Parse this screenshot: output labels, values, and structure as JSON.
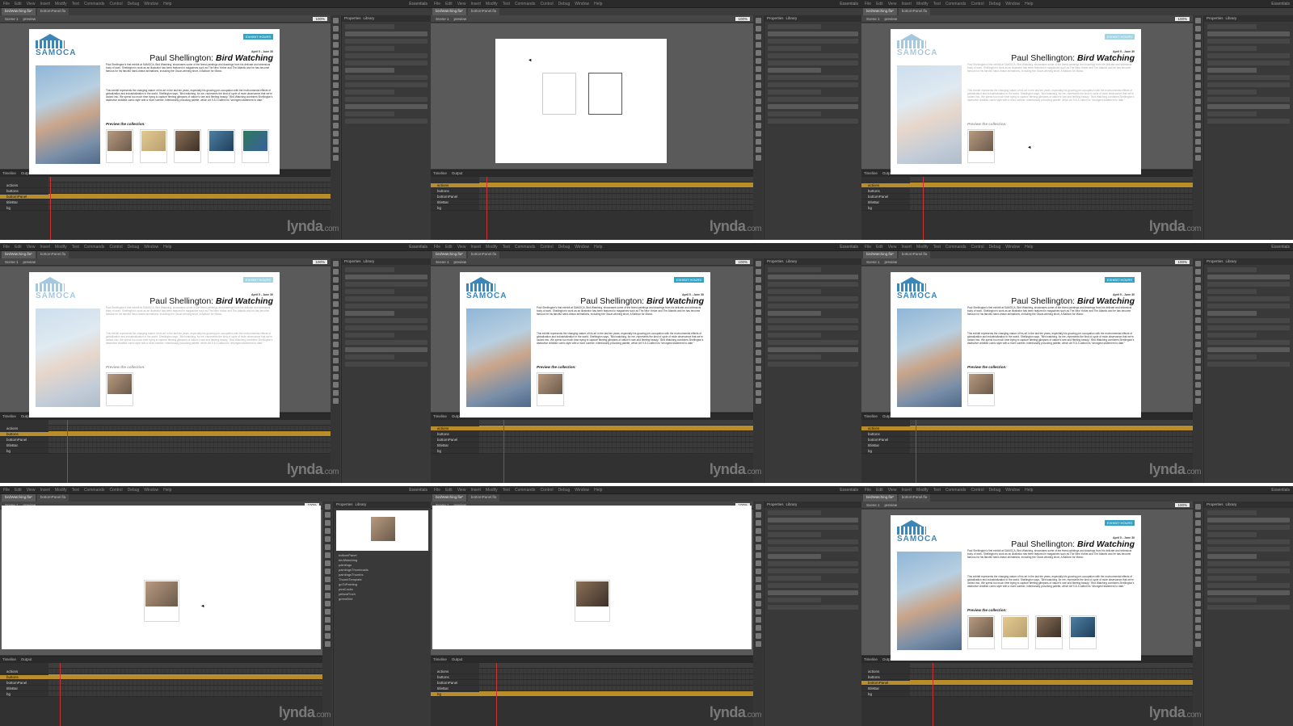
{
  "menu": [
    "File",
    "Edit",
    "View",
    "Insert",
    "Modify",
    "Text",
    "Commands",
    "Control",
    "Debug",
    "Window",
    "Help"
  ],
  "workspace_label": "Essentials",
  "tabs": [
    "birdWatching.fla*",
    "bottomPanel.fla"
  ],
  "edit_bar": {
    "scene": "Scene 1",
    "symbol": "preview",
    "zoom": "100%"
  },
  "panel_tabs": [
    "Properties",
    "Library"
  ],
  "timeline_tabs": [
    "Timeline",
    "Output"
  ],
  "layers": [
    "actions",
    "buttons",
    "bottomPanel",
    "titleBar",
    "bg"
  ],
  "library_items": [
    "bottomPanel",
    "birdWatching",
    "paintings",
    "paintingsThumbnails",
    "paintingsThumbs",
    "ThumbTemplate",
    "goToPainting",
    "peaCocks",
    "yellowFinch",
    "greenBird"
  ],
  "watermark": "lynda",
  "watermark_suffix": ".com",
  "ad": {
    "logo": "SAMOCA",
    "button": "EXHIBIT HOURS",
    "title_artist": "Paul Shellington: ",
    "title_show": "Bird Watching",
    "date": "April 5 - June 30",
    "body_1": "Paul Shellington's first exhibit at SAMOCA, Bird Watching, showcases some of the finest paintings and drawings from his delicate and whimsical body of work. Shellington's work as an illustrator has been featured in magazines such as The New Yorker and The Atlantic and he has become famous for his fanciful hand-drawn animations, including the Oscar-winning short, A Balloon for Marco.",
    "body_2": "This exhibit represents the changing nature of his art in the last ten years, especially his growing pre-occupation with the environmental effects of globalization and industrialization in the world. Shellington says, \"Bird watching, for me, represents the kind of cycle of mute observance that we're locked into. We spend too much time trying to capture fleeting glimpses of nature's rare and fleeting beauty.\" Bird Watching combines Shellington's distinctive childlike comic style with a more somber, intentionally provoking palette, which Art 9-5-3 called his \"strongest statement to date.\"",
    "preview_label": "Preview the collection:"
  },
  "colors": {
    "accent": "#33a3c6",
    "brand": "#3a86b8",
    "selected_layer": "#b88d2a",
    "playhead": "#d03030"
  }
}
